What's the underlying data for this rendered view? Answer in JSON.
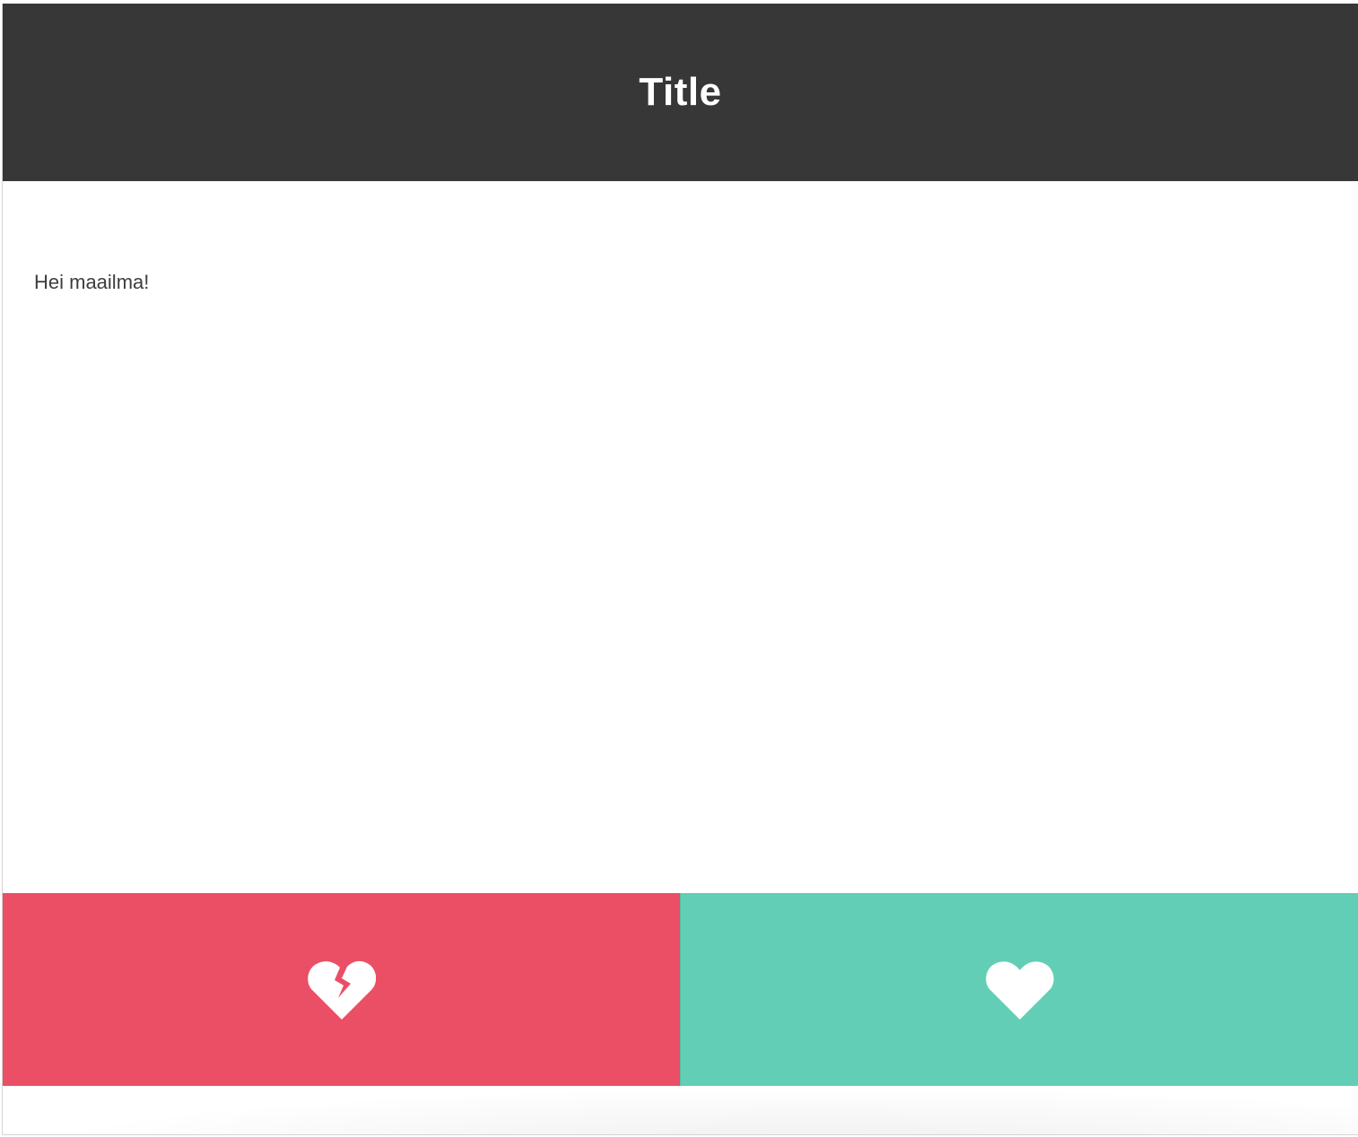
{
  "header": {
    "title": "Title"
  },
  "main": {
    "text": "Hei maailma!"
  },
  "actions": {
    "dislike": {
      "icon": "broken-heart-icon"
    },
    "like": {
      "icon": "heart-icon"
    }
  },
  "colors": {
    "header_bg": "#373737",
    "dislike_bg": "#ea4f65",
    "like_bg": "#62ceb5",
    "text": "#3d3d3d"
  }
}
